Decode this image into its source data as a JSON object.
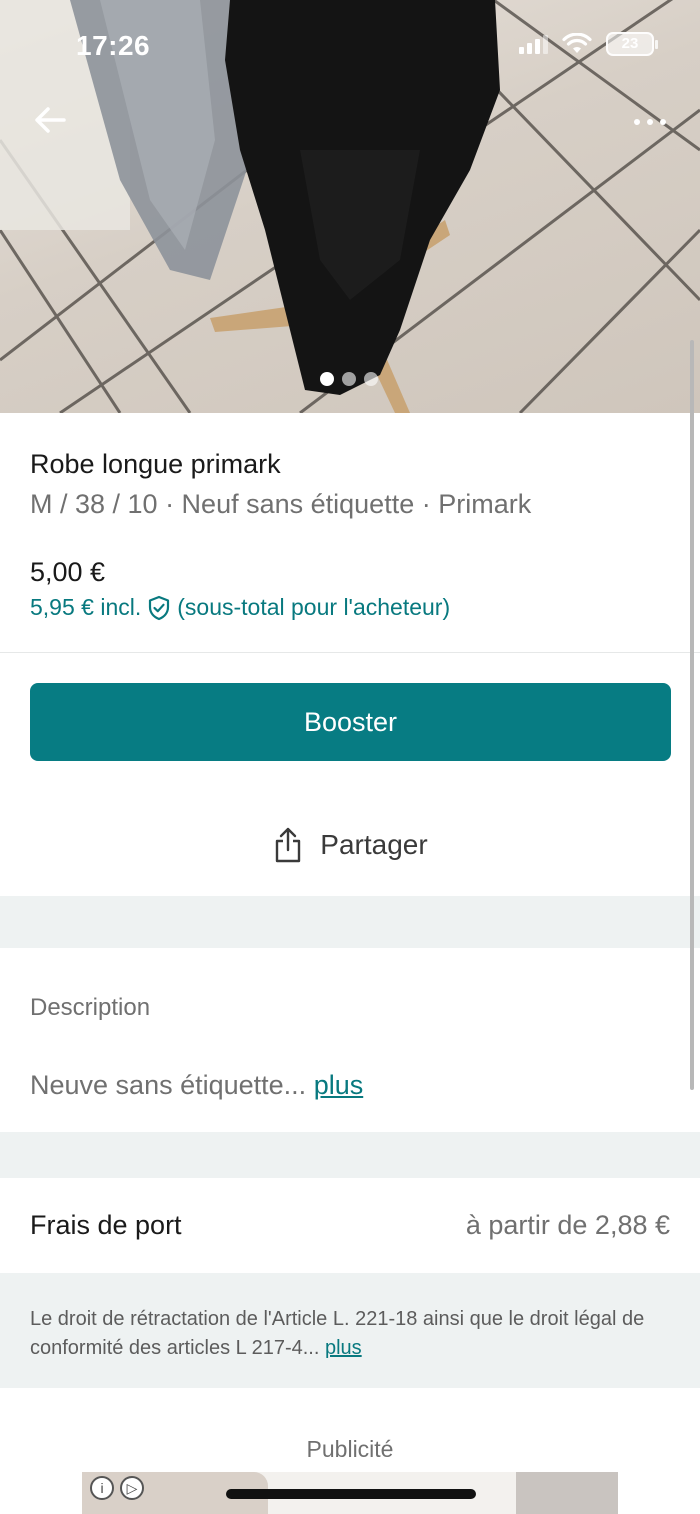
{
  "status_bar": {
    "time": "17:26",
    "battery": "23"
  },
  "product": {
    "title": "Robe longue primark",
    "subtitle": "M / 38 / 10 · Neuf sans étiquette · Primark",
    "price": "5,00 €",
    "price_incl": "5,95 € incl.",
    "price_incl_note": "(sous-total pour l'acheteur)",
    "photo_count": 3,
    "active_photo": 1
  },
  "actions": {
    "booster": "Booster",
    "share": "Partager"
  },
  "description": {
    "title": "Description",
    "text": "Neuve sans étiquette...",
    "more": "plus"
  },
  "shipping": {
    "label": "Frais de port",
    "value": "à partir de 2,88 €"
  },
  "legal": {
    "text": "Le droit de rétractation de l'Article L. 221-18 ainsi que le droit légal de conformité des articles L 217-4...",
    "more": "plus"
  },
  "ad": {
    "label": "Publicité"
  },
  "colors": {
    "accent": "#077c83",
    "link": "#08797f",
    "section_gap": "#eef2f2"
  },
  "icons": [
    "back-arrow-icon",
    "more-options-icon",
    "shield-check-icon",
    "share-icon",
    "signal-icon",
    "wifi-icon",
    "battery-icon",
    "ad-info-icon",
    "ad-play-icon"
  ]
}
